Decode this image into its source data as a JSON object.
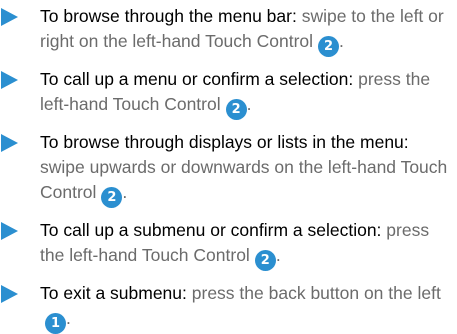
{
  "colors": {
    "accent": "#2b8fd0",
    "heading_text": "#000000",
    "body_text": "#6b6b6b"
  },
  "instructions": [
    {
      "heading": "To browse through the menu bar:",
      "text": "swipe to the left or right on the left-hand Touch Control",
      "callout": "2"
    },
    {
      "heading": "To call up a menu or confirm a selection:",
      "text": "press the left-hand Touch Control",
      "callout": "2"
    },
    {
      "heading": "To browse through displays or lists in the menu:",
      "text": "swipe upwards or downwards on the left-hand Touch Control",
      "callout": "2"
    },
    {
      "heading": "To call up a submenu or confirm a selection:",
      "text": "press the left-hand Touch Control",
      "callout": "2"
    },
    {
      "heading": "To exit a submenu:",
      "text": "press the back button on the left",
      "callout": "1"
    }
  ]
}
